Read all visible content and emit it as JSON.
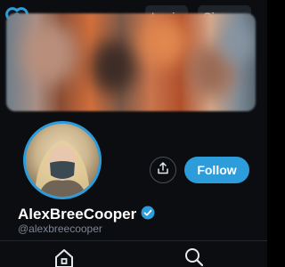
{
  "header": {
    "logo_icon": "heart-lock-logo-icon",
    "login_label": "Login",
    "signup_label": "Sign up"
  },
  "profile": {
    "display_name": "AlexBreeCooper",
    "username": "@alexbreecooper",
    "verified_icon": "verified-badge-icon",
    "follow_label": "Follow",
    "share_icon": "share-icon"
  },
  "bottom_nav": {
    "items": [
      {
        "icon": "home-icon"
      },
      {
        "icon": "search-icon"
      }
    ]
  },
  "colors": {
    "accent": "#2d9cdb",
    "background": "#0b0d10",
    "button_dark": "#1f242b",
    "muted_text": "#7c8794"
  }
}
